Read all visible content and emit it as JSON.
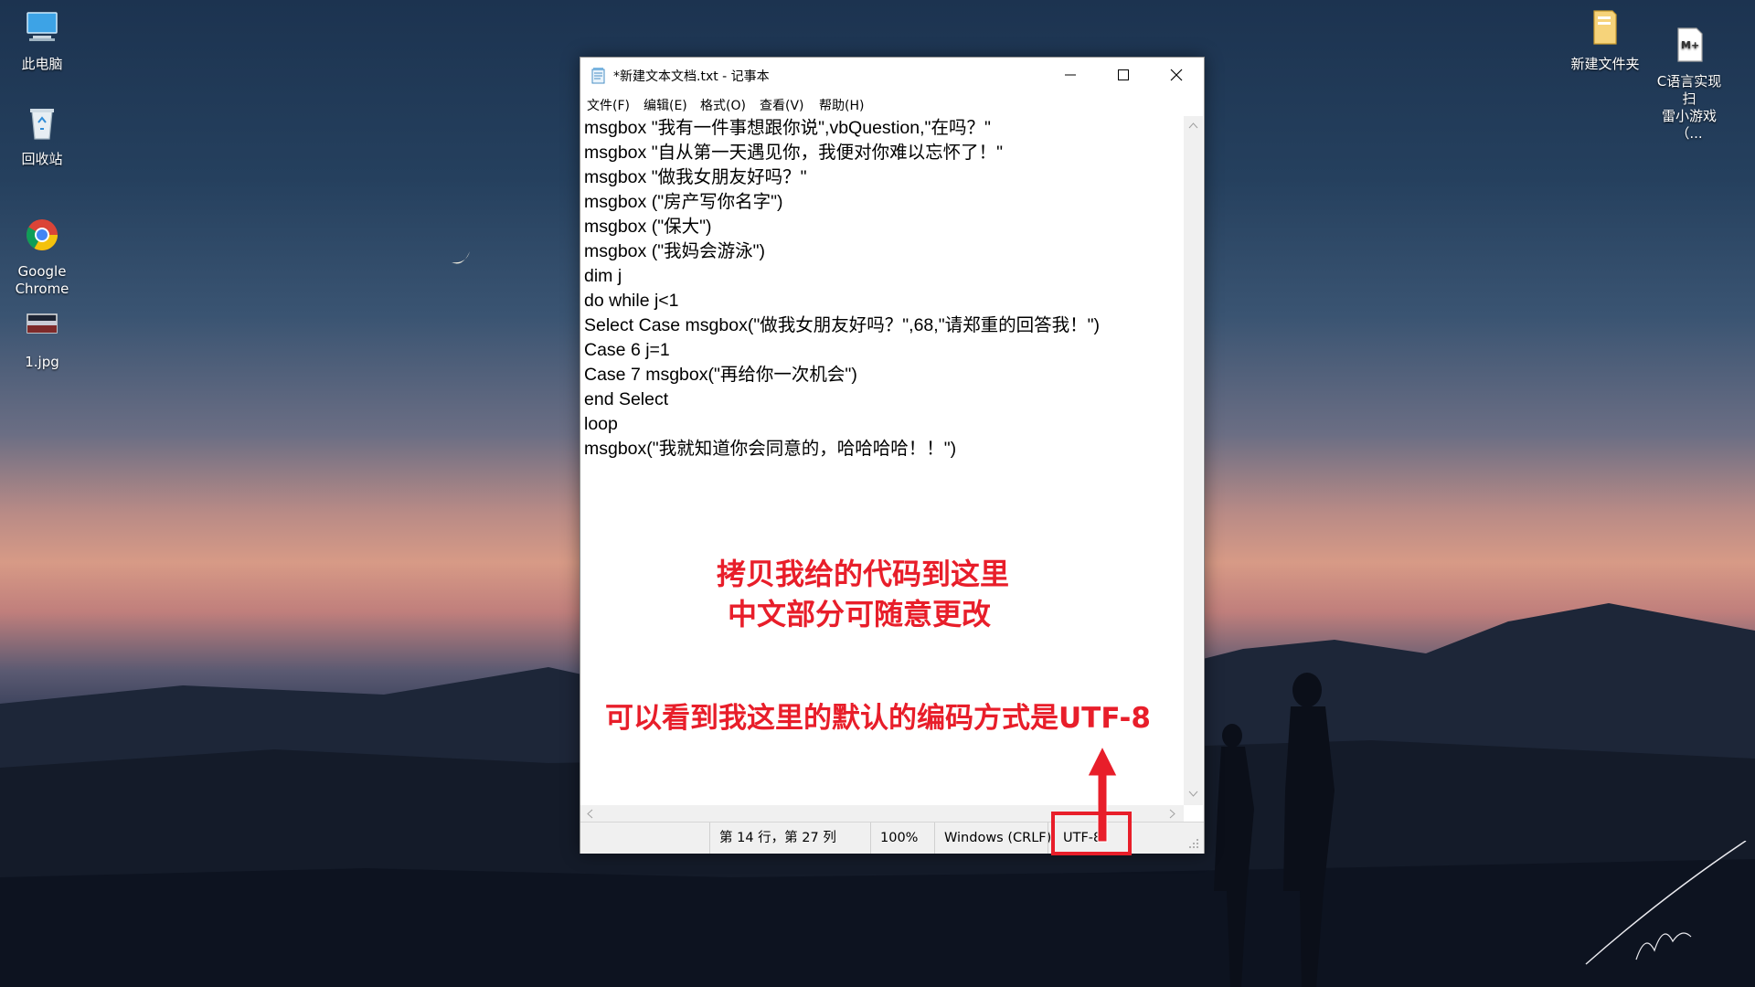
{
  "desktop": {
    "icons_left": [
      {
        "label": "此电脑",
        "icon": "computer-icon"
      },
      {
        "label": "回收站",
        "icon": "recycle-bin-icon"
      },
      {
        "label": "Google\nChrome",
        "icon": "chrome-icon"
      },
      {
        "label": "1.jpg",
        "icon": "image-file-icon"
      }
    ],
    "icons_right": [
      {
        "label": "新建文件夹",
        "icon": "folder-icon"
      },
      {
        "label": "C语言实现扫\n雷小游戏（...",
        "icon": "markdown-file-icon"
      }
    ]
  },
  "notepad": {
    "title": "*新建文本文档.txt - 记事本",
    "menu": [
      "文件(F)",
      "编辑(E)",
      "格式(O)",
      "查看(V)",
      "帮助(H)"
    ],
    "lines": [
      "msgbox \"我有一件事想跟你说\",vbQuestion,\"在吗？\"",
      "msgbox \"自从第一天遇见你，我便对你难以忘怀了！\"",
      "msgbox \"做我女朋友好吗？\"",
      "msgbox (\"房产写你名字\")",
      "msgbox (\"保大\")",
      "msgbox (\"我妈会游泳\")",
      "dim j",
      "do while j<1",
      "Select Case msgbox(\"做我女朋友好吗？\",68,\"请郑重的回答我！\")",
      "Case 6 j=1",
      "Case 7 msgbox(\"再给你一次机会\")",
      "end Select",
      "loop",
      "msgbox(\"我就知道你会同意的，哈哈哈哈！！\")"
    ],
    "status": {
      "position": "第 14 行，第 27 列",
      "zoom": "100%",
      "line_ending": "Windows (CRLF)",
      "encoding": "UTF-8"
    }
  },
  "annotations": {
    "line1": "拷贝我给的代码到这里",
    "line2": "中文部分可随意更改",
    "line3": "可以看到我这里的默认的编码方式是UTF-8",
    "highlight_color": "#e81e2a"
  }
}
